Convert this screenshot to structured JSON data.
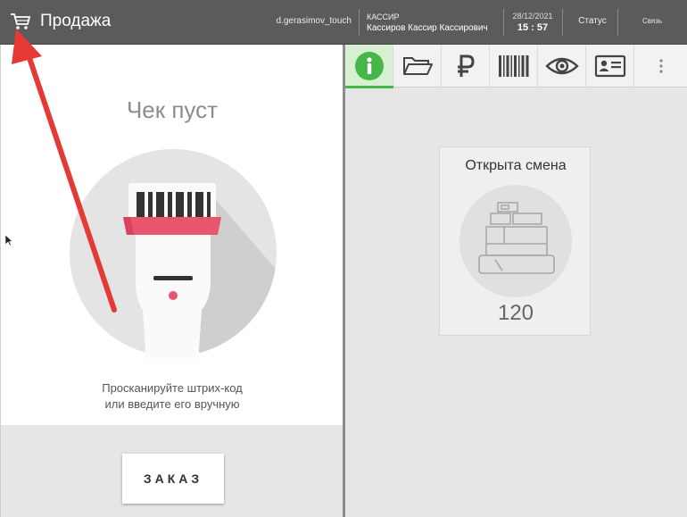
{
  "header": {
    "title": "Продажа",
    "login": "d.gerasimov_touch",
    "role": "КАССИР",
    "cashier_name": "Кассиров Кассир Кассирович",
    "date": "28/12/2021",
    "time": "15 : 57",
    "status": "Статус",
    "connection": "Связь"
  },
  "receipt": {
    "empty_title": "Чек пуст",
    "hint_line1": "Просканируйте штрих-код",
    "hint_line2": "или введите его вручную",
    "order_button": "ЗАКАЗ"
  },
  "tabs": [
    "info-icon",
    "folder-open-icon",
    "ruble-icon",
    "barcode-icon",
    "eye-icon",
    "id-card-icon",
    "more-vertical-icon"
  ],
  "shift_card": {
    "title": "Открыта смена",
    "number": "120"
  },
  "colors": {
    "header_bg": "#5b5b5b",
    "active_tab": "#46b649",
    "annotation_arrow": "#e53935",
    "scanner_accent": "#e8566e"
  }
}
